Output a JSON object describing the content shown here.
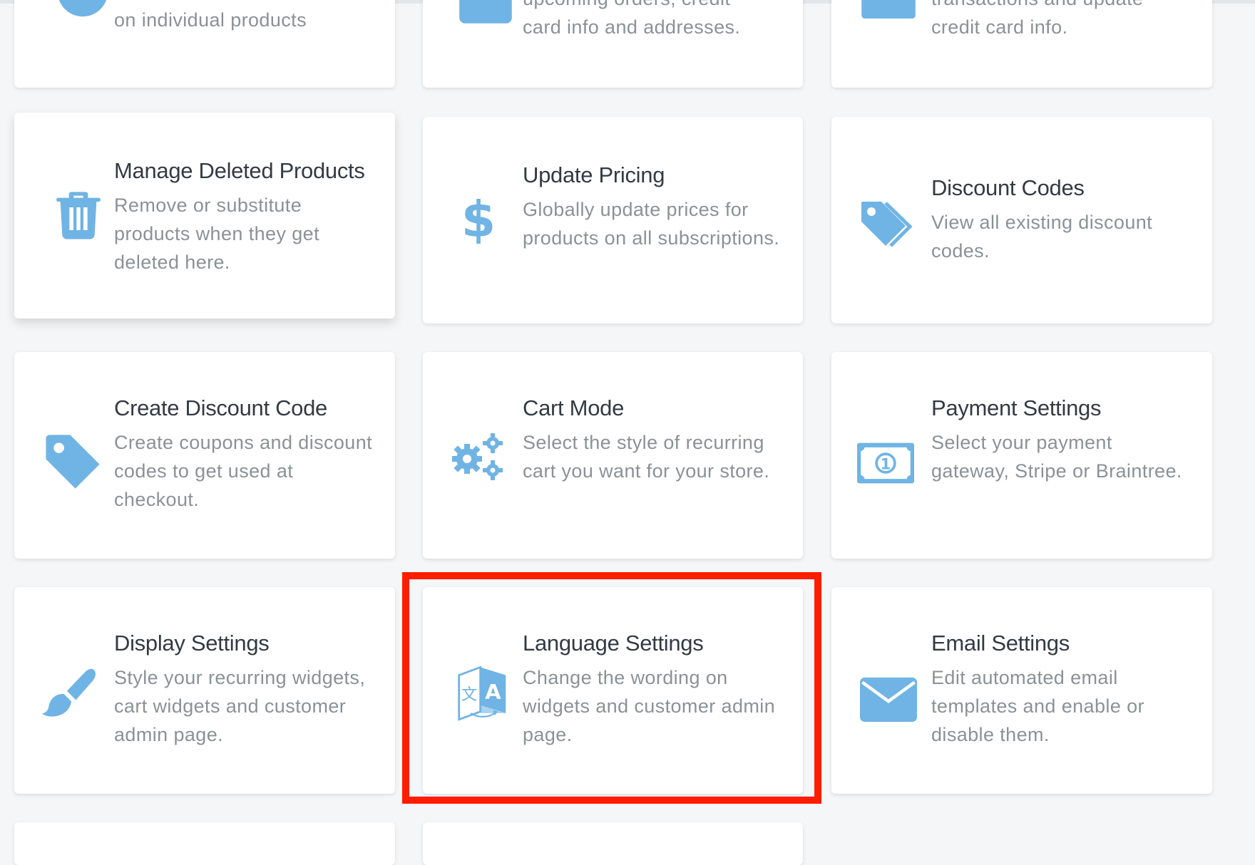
{
  "accent_color": "#6fb4e4",
  "highlight_color": "#ff1d00",
  "cards_partial_top": [
    {
      "name": "top-card-1",
      "desc": "on individual products"
    },
    {
      "name": "top-card-2",
      "desc_line1": "upcoming orders, credit",
      "desc_line2": "card info and addresses."
    },
    {
      "name": "top-card-3",
      "desc_line1": "transactions and update",
      "desc_line2": "credit card info."
    }
  ],
  "cards": [
    {
      "title": "Manage Deleted Products",
      "desc": "Remove or substitute products when they get deleted here.",
      "icon": "trash-icon"
    },
    {
      "title": "Update Pricing",
      "desc": "Globally update prices for products on all subscriptions.",
      "icon": "dollar-icon"
    },
    {
      "title": "Discount Codes",
      "desc": "View all existing discount codes.",
      "icon": "tags-icon"
    },
    {
      "title": "Create Discount Code",
      "desc": "Create coupons and discount codes to get used at checkout.",
      "icon": "tag-icon"
    },
    {
      "title": "Cart Mode",
      "desc": "Select the style of recurring cart you want for your store.",
      "icon": "gears-icon"
    },
    {
      "title": "Payment Settings",
      "desc": "Select your payment gateway, Stripe or Braintree.",
      "icon": "money-icon"
    },
    {
      "title": "Display Settings",
      "desc": "Style your recurring widgets, cart widgets and customer admin page.",
      "icon": "paintbrush-icon"
    },
    {
      "title": "Language Settings",
      "desc": "Change the wording on widgets and customer admin page.",
      "icon": "translate-icon"
    },
    {
      "title": "Email Settings",
      "desc": "Edit automated email templates and enable or disable them.",
      "icon": "envelope-icon"
    }
  ]
}
